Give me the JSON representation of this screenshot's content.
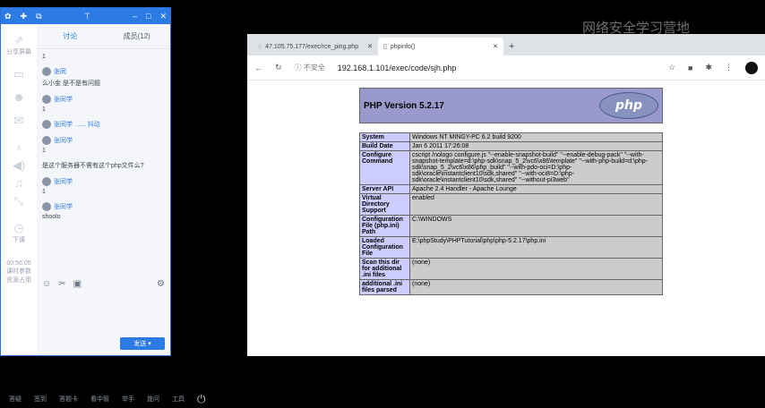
{
  "watermark": "网络安全学习营地",
  "chat": {
    "tabs": [
      "讨论",
      "成员(12)"
    ],
    "messages": [
      {
        "user": "",
        "text": "1"
      },
      {
        "user": "张同",
        "text": "么小金 是不是有问题"
      },
      {
        "user": "张同学",
        "text": "1"
      },
      {
        "user": "张同学",
        "text": "...... 抖动"
      },
      {
        "user": "张同学",
        "text": "1"
      },
      {
        "user": "张同学",
        "text": "是这个服务器不需有这个php文件么?"
      },
      {
        "user": "张同学",
        "text": "1"
      },
      {
        "user": "张同学",
        "text": "shoolo"
      }
    ],
    "send_label": "发送"
  },
  "sidebar": {
    "items": [
      {
        "icon": "share-icon",
        "label": "分享屏幕"
      },
      {
        "icon": "screen-icon",
        "label": ""
      },
      {
        "icon": "person-icon",
        "label": ""
      },
      {
        "icon": "chat-icon",
        "label": ""
      },
      {
        "icon": "mic-icon",
        "label": ""
      },
      {
        "icon": "speaker-icon",
        "label": ""
      },
      {
        "icon": "music-icon",
        "label": ""
      },
      {
        "icon": "expand-icon",
        "label": ""
      },
      {
        "icon": "clock-icon",
        "label": "下课"
      }
    ],
    "timer": "00:56:05",
    "stats1": "课时参数",
    "stats2": "资源占用"
  },
  "browser": {
    "tabs": [
      {
        "title": "47.105.75.177/exec/rce_ping.php"
      },
      {
        "title": "phpinfo()"
      }
    ],
    "security": "不安全",
    "url": "192.168.1.101/exec/code/sjh.php"
  },
  "phpinfo": {
    "title": "PHP Version 5.2.17",
    "logo": "php",
    "rows": [
      {
        "k": "System",
        "v": "Windows NT MINGY-PC 6.2 build 9200"
      },
      {
        "k": "Build Date",
        "v": "Jan 6 2011 17:26:08"
      },
      {
        "k": "Configure Command",
        "v": "cscript /nologo configure.js \"--enable-snapshot-build\" \"--enable-debug-pack\" \"--with-snapshot-template=d:\\php-sdk\\snap_5_2\\vc6\\x86\\template\" \"--with-php-build=d:\\php-sdk\\snap_5_2\\vc6\\x86\\php_build\" \"--with-pdo-oci=D:\\php-sdk\\oracle\\instantclient10\\sdk,shared\" \"--with-oci8=D:\\php-sdk\\oracle\\instantclient10\\sdk,shared\" \"--without-pi3web\""
      },
      {
        "k": "Server API",
        "v": "Apache 2.4 Handler - Apache Lounge"
      },
      {
        "k": "Virtual Directory Support",
        "v": "enabled"
      },
      {
        "k": "Configuration File (php.ini) Path",
        "v": "C:\\WINDOWS"
      },
      {
        "k": "Loaded Configuration File",
        "v": "E:\\phpStudy\\PHPTutorial\\php\\php-5.2.17\\php.ini"
      },
      {
        "k": "Scan this dir for additional .ini files",
        "v": "(none)"
      },
      {
        "k": "additional .ini files parsed",
        "v": "(none)"
      }
    ]
  },
  "taskbar": {
    "items": [
      "答疑",
      "签到",
      "答题卡",
      "看中智",
      "举手",
      "提问",
      "工具"
    ]
  }
}
